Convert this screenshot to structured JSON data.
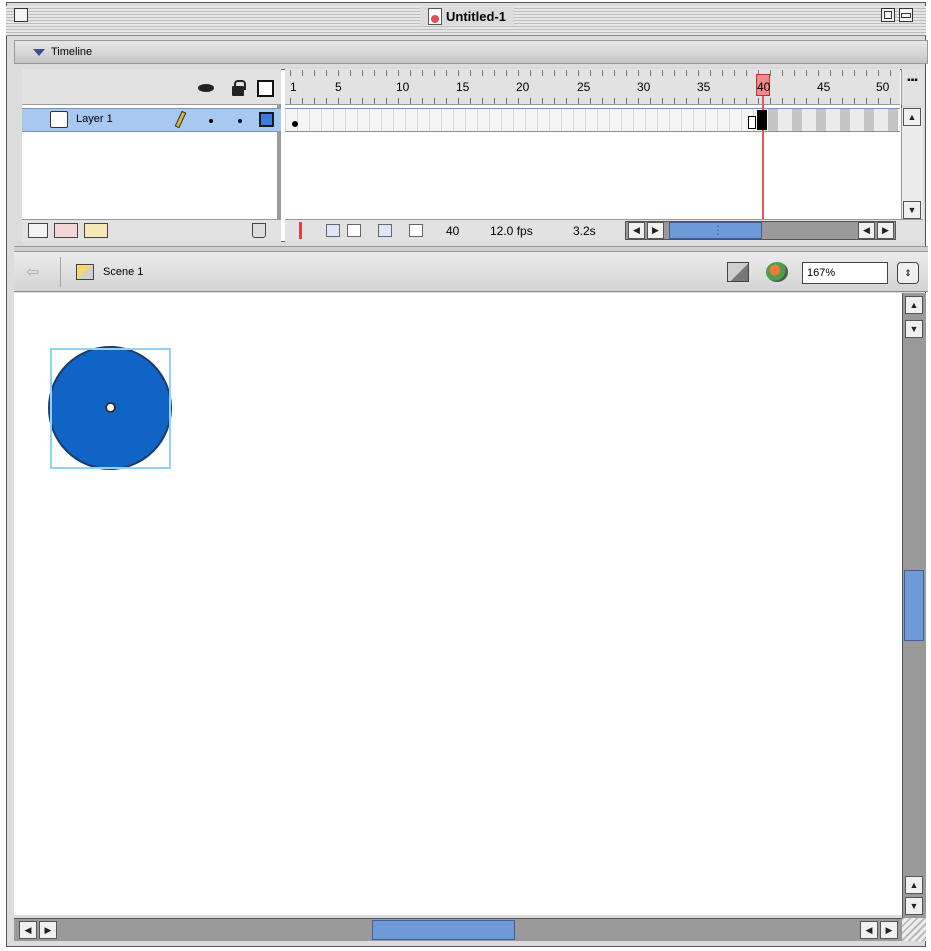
{
  "window": {
    "title": "Untitled-1"
  },
  "timeline": {
    "panel_title": "Timeline",
    "layer_name": "Layer 1",
    "frame_numbers": [
      "1",
      "5",
      "10",
      "15",
      "20",
      "25",
      "30",
      "35",
      "40",
      "45",
      "50"
    ],
    "current_frame": "40",
    "frame_readout": "40",
    "fps_readout": "12.0 fps",
    "elapsed_readout": "3.2s"
  },
  "edit_bar": {
    "scene_label": "Scene 1",
    "zoom_value": "167%"
  },
  "colors": {
    "circle_fill": "#0f64c5",
    "layer_selected": "#a7c8f0",
    "playhead": "#e05858",
    "selection_outline": "#8fd2f5"
  },
  "icons": [
    "doc-icon",
    "eye-icon",
    "lock-icon",
    "outline-icon",
    "layer-icon",
    "pencil-icon",
    "add-layer-icon",
    "add-guide-icon",
    "add-folder-icon",
    "delete-layer-icon",
    "center-frame-icon",
    "onion-skin-icon",
    "onion-outline-icon",
    "edit-multiple-icon",
    "onion-markers-icon",
    "scene-icon",
    "edit-scene-icon",
    "edit-symbol-icon"
  ]
}
